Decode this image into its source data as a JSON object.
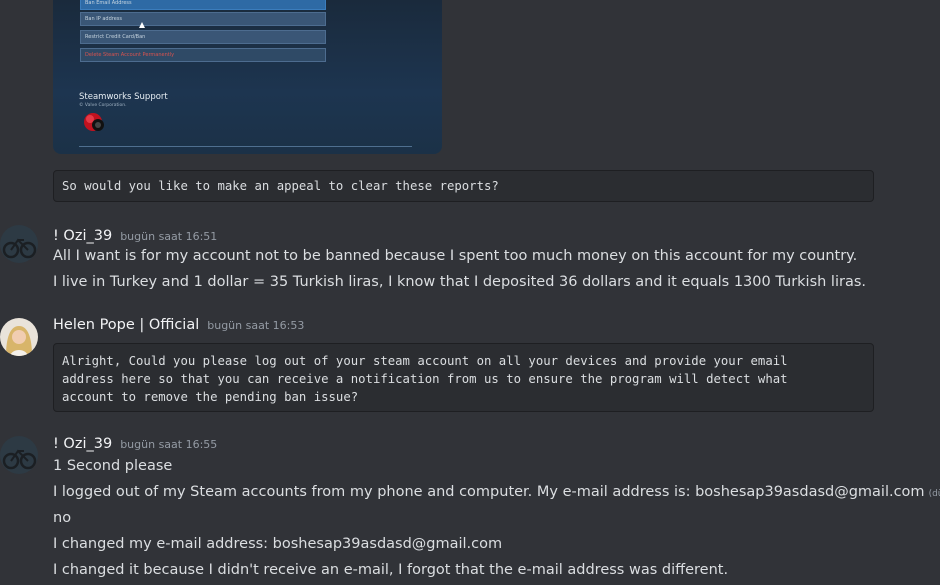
{
  "embed": {
    "rows": [
      "Ban Email Address",
      "Ban IP address",
      "Restrict Credit Card/Ban",
      "Delete Steam Account Permanently"
    ],
    "title": "Steamworks Support",
    "subtitle": "© Valve Corporation."
  },
  "messages": [
    {
      "code": "So would you like to make an appeal to clear these reports?"
    },
    {
      "author": "! Ozi_39",
      "timestamp": "bugün saat 16:51",
      "lines": [
        "All I want is for my account not to be banned because I spent too much money on this account for my country.",
        "I live in Turkey and 1 dollar = 35 Turkish liras, I know that I deposited 36 dollars and it equals 1300 Turkish liras."
      ]
    },
    {
      "author": "Helen Pope | Official",
      "timestamp": "bugün saat 16:53",
      "code": "Alright, Could you please log out of your steam account on all your devices and provide your email\naddress here so that you can receive a notification from us to ensure the program will detect what\naccount to remove the pending ban issue?"
    },
    {
      "author": "! Ozi_39",
      "timestamp": "bugün saat 16:55",
      "lines": [
        "1 Second please",
        "I logged out of my Steam accounts from my phone and computer. My e-mail address is: boshesap39asdasd@gmail.com",
        "no",
        "I changed my e-mail address: boshesap39asdasd@gmail.com",
        "I changed it because I didn't receive an e-mail, I forgot that the e-mail address was different."
      ],
      "edited_label": "(düzenlendi)"
    }
  ]
}
